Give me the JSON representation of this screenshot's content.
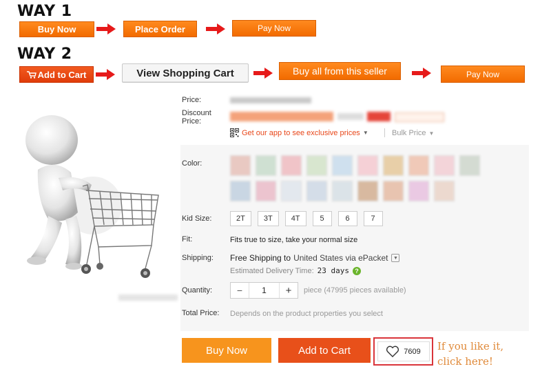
{
  "way1": {
    "label": "WAY 1",
    "steps": [
      "Buy Now",
      "Place Order",
      "Pay Now"
    ]
  },
  "way2": {
    "label": "WAY 2",
    "steps": [
      "Add to Cart",
      "View Shopping Cart",
      "Buy all from this seller",
      "Pay Now"
    ]
  },
  "product": {
    "price_label": "Price:",
    "discount_label_1": "Discount",
    "discount_label_2": "Price:",
    "app_link": "Get our app to see exclusive prices",
    "bulk_price": "Bulk Price",
    "color_label": "Color:",
    "kid_size_label": "Kid Size:",
    "sizes": [
      "2T",
      "3T",
      "4T",
      "5",
      "6",
      "7"
    ],
    "fit_label": "Fit:",
    "fit_value": "Fits true to size, take your normal size",
    "shipping_label": "Shipping:",
    "shipping_value_prefix": "Free Shipping to",
    "shipping_destination": "United States via ePacket",
    "delivery_label": "Estimated Delivery Time:",
    "delivery_value": "23 days",
    "quantity_label": "Quantity:",
    "quantity_value": "1",
    "quantity_minus": "−",
    "quantity_plus": "+",
    "pieces_available": "piece (47995 pieces available)",
    "total_label": "Total Price:",
    "total_value": "Depends on the product properties you select",
    "buy_now": "Buy Now",
    "add_to_cart": "Add to Cart",
    "wishlist_count": "7609"
  },
  "annotation": {
    "line1": "If you like it,",
    "line2": "click here!"
  },
  "colors": {
    "orange": "#f57c00",
    "red_orange": "#e8471a",
    "annotation": "#e08a3a",
    "highlight_box": "#d9343a"
  }
}
